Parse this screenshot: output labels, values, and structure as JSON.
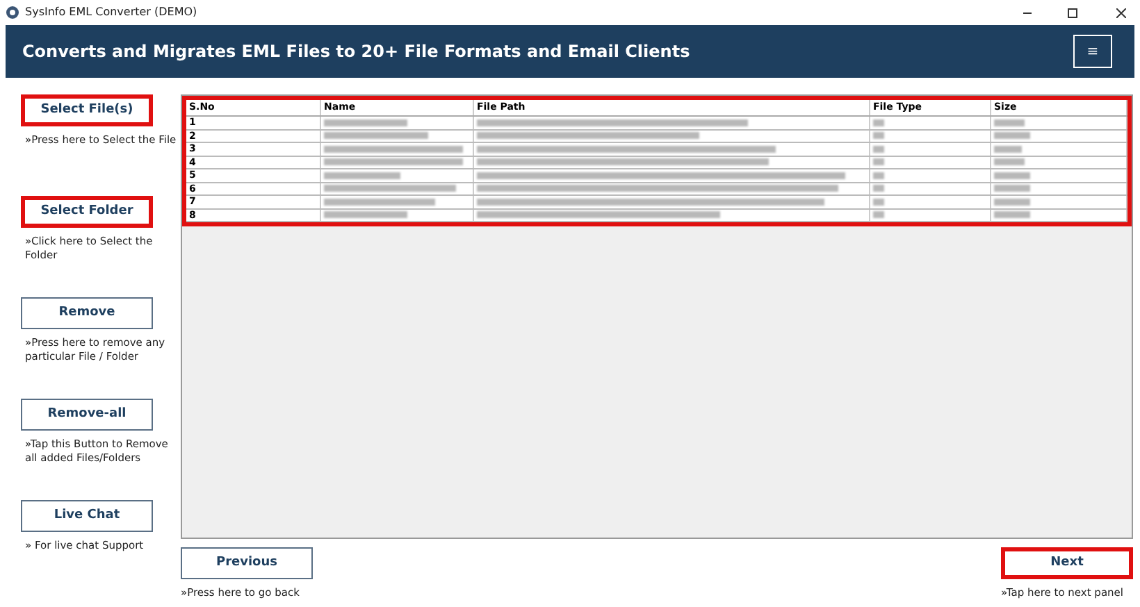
{
  "window": {
    "title": "SysInfo EML Converter (DEMO)"
  },
  "header": {
    "title": "Converts and Migrates EML Files to 20+ File Formats and Email Clients",
    "menu_button": "≡"
  },
  "sidebar": [
    {
      "label": "Select File(s)",
      "hint": "»Press here to Select the File",
      "highlighted": true
    },
    {
      "label": "Select Folder",
      "hint": "»Click here to Select the Folder",
      "highlighted": true
    },
    {
      "label": "Remove",
      "hint": "»Press here to remove any particular File / Folder",
      "highlighted": false
    },
    {
      "label": "Remove-all",
      "hint": "»Tap this Button to Remove all added Files/Folders",
      "highlighted": false
    },
    {
      "label": "Live Chat",
      "hint": "» For live chat Support",
      "highlighted": false
    }
  ],
  "table": {
    "highlighted": true,
    "columns": [
      "S.No",
      "Name",
      "File Path",
      "File Type",
      "Size"
    ],
    "rows": [
      {
        "sno": "1"
      },
      {
        "sno": "2"
      },
      {
        "sno": "3"
      },
      {
        "sno": "4"
      },
      {
        "sno": "5"
      },
      {
        "sno": "6"
      },
      {
        "sno": "7"
      },
      {
        "sno": "8"
      }
    ]
  },
  "footer": {
    "previous": {
      "label": "Previous",
      "hint": "»Press here to go back",
      "highlighted": false
    },
    "next": {
      "label": "Next",
      "hint": "»Tap here to next panel",
      "highlighted": true
    }
  }
}
